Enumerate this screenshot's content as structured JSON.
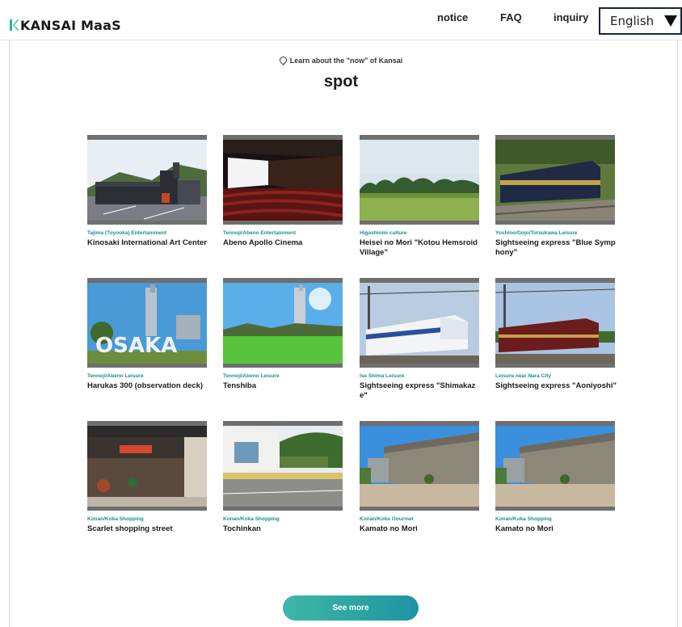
{
  "header": {
    "logo_text": "KANSAI MaaS",
    "nav": {
      "notice": "notice",
      "faq": "FAQ",
      "inquiry": "inquiry"
    },
    "language": {
      "selected": "English"
    }
  },
  "section": {
    "eyebrow": "Learn about the \"now\" of Kansai",
    "title": "spot"
  },
  "spots": [
    {
      "tag": "Tajima (Toyooka) Entertainment",
      "name": "Kinosaki International Art Center"
    },
    {
      "tag": "Tennoji/Abeno Entertainment",
      "name": "Abeno Apollo Cinema"
    },
    {
      "tag": "Higashiomi culture",
      "name": "Heisei no Mori \"Kotou Hemsroid Village\""
    },
    {
      "tag": "Yoshino/Gojo/Totsukawa Leisure",
      "name": "Sightseeing express \"Blue Symphony\""
    },
    {
      "tag": "Tennoji/Abeno Leisure",
      "name": "Harukas 300 (observation deck)"
    },
    {
      "tag": "Tennoji/Abeno Leisure",
      "name": "Tenshiba"
    },
    {
      "tag": "Ise Shima Leisure",
      "name": "Sightseeing express \"Shimakaze\""
    },
    {
      "tag": "Leisure near Nara City",
      "name": "Sightseeing express \"Aoniyoshi\""
    },
    {
      "tag": "Konan/Koka Shopping",
      "name": "Scarlet shopping street"
    },
    {
      "tag": "Konan/Koka Shopping",
      "name": "Tochinkan"
    },
    {
      "tag": "Konan/Koka Gourmet",
      "name": "Kamato no Mori"
    },
    {
      "tag": "Konan/Koka Shopping",
      "name": "Kamato no Mori"
    }
  ],
  "see_more_label": "See more",
  "colors": {
    "accent": "#1a8f8a",
    "button_gradient_start": "#3fb6a7",
    "button_gradient_end": "#1f93a6",
    "lang_border": "#1a2440"
  }
}
